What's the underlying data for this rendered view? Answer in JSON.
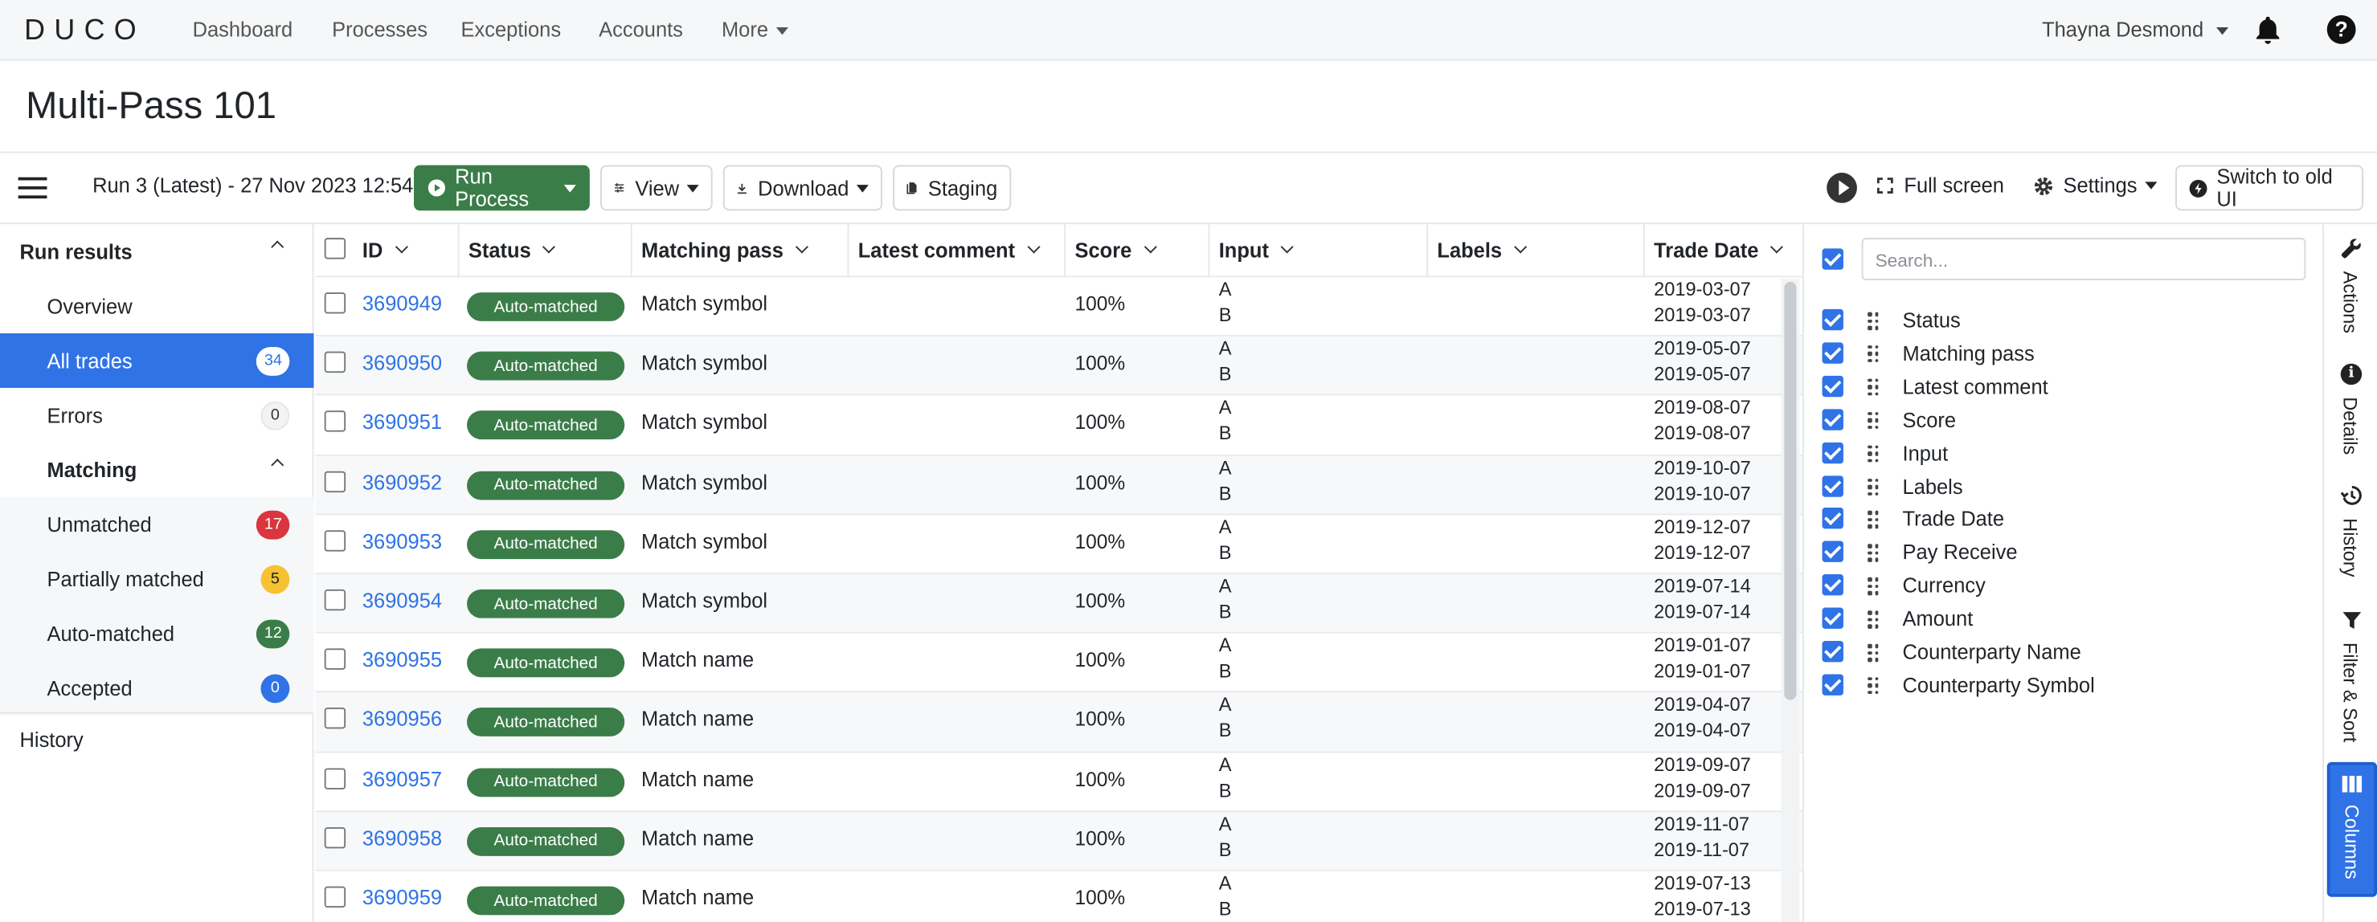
{
  "nav": {
    "logo": "DUCO",
    "links": [
      "Dashboard",
      "Processes",
      "Exceptions",
      "Accounts",
      "More"
    ],
    "user": "Thayna Desmond"
  },
  "page": {
    "title": "Multi-Pass 101"
  },
  "toolbar": {
    "run": "Run 3 (Latest) - 27 Nov 2023 12:54",
    "run_process": "Run Process",
    "view": "View",
    "download": "Download",
    "staging": "Staging",
    "full_screen": "Full screen",
    "settings": "Settings",
    "switch_ui": "Switch to old UI"
  },
  "sidebar": {
    "run_results": "Run results",
    "overview": "Overview",
    "all_trades": "All trades",
    "all_trades_count": "34",
    "errors": "Errors",
    "errors_count": "0",
    "matching": "Matching",
    "unmatched": "Unmatched",
    "unmatched_count": "17",
    "partially": "Partially matched",
    "partially_count": "5",
    "auto": "Auto-matched",
    "auto_count": "12",
    "accepted": "Accepted",
    "accepted_count": "0",
    "history": "History"
  },
  "table": {
    "headers": [
      "ID",
      "Status",
      "Matching pass",
      "Latest comment",
      "Score",
      "Input",
      "Labels",
      "Trade Date"
    ],
    "rows": [
      {
        "id": "3690949",
        "status": "Auto-matched",
        "pass": "Match symbol",
        "score": "100%",
        "in_a": "A",
        "in_b": "B",
        "d1": "2019-03-07",
        "d2": "2019-03-07"
      },
      {
        "id": "3690950",
        "status": "Auto-matched",
        "pass": "Match symbol",
        "score": "100%",
        "in_a": "A",
        "in_b": "B",
        "d1": "2019-05-07",
        "d2": "2019-05-07"
      },
      {
        "id": "3690951",
        "status": "Auto-matched",
        "pass": "Match symbol",
        "score": "100%",
        "in_a": "A",
        "in_b": "B",
        "d1": "2019-08-07",
        "d2": "2019-08-07"
      },
      {
        "id": "3690952",
        "status": "Auto-matched",
        "pass": "Match symbol",
        "score": "100%",
        "in_a": "A",
        "in_b": "B",
        "d1": "2019-10-07",
        "d2": "2019-10-07"
      },
      {
        "id": "3690953",
        "status": "Auto-matched",
        "pass": "Match symbol",
        "score": "100%",
        "in_a": "A",
        "in_b": "B",
        "d1": "2019-12-07",
        "d2": "2019-12-07"
      },
      {
        "id": "3690954",
        "status": "Auto-matched",
        "pass": "Match symbol",
        "score": "100%",
        "in_a": "A",
        "in_b": "B",
        "d1": "2019-07-14",
        "d2": "2019-07-14"
      },
      {
        "id": "3690955",
        "status": "Auto-matched",
        "pass": "Match name",
        "score": "100%",
        "in_a": "A",
        "in_b": "B",
        "d1": "2019-01-07",
        "d2": "2019-01-07"
      },
      {
        "id": "3690956",
        "status": "Auto-matched",
        "pass": "Match name",
        "score": "100%",
        "in_a": "A",
        "in_b": "B",
        "d1": "2019-04-07",
        "d2": "2019-04-07"
      },
      {
        "id": "3690957",
        "status": "Auto-matched",
        "pass": "Match name",
        "score": "100%",
        "in_a": "A",
        "in_b": "B",
        "d1": "2019-09-07",
        "d2": "2019-09-07"
      },
      {
        "id": "3690958",
        "status": "Auto-matched",
        "pass": "Match name",
        "score": "100%",
        "in_a": "A",
        "in_b": "B",
        "d1": "2019-11-07",
        "d2": "2019-11-07"
      },
      {
        "id": "3690959",
        "status": "Auto-matched",
        "pass": "Match name",
        "score": "100%",
        "in_a": "A",
        "in_b": "B",
        "d1": "2019-07-13",
        "d2": "2019-07-13"
      }
    ]
  },
  "columns_panel": {
    "search_placeholder": "Search...",
    "items": [
      "Status",
      "Matching pass",
      "Latest comment",
      "Score",
      "Input",
      "Labels",
      "Trade Date",
      "Pay Receive",
      "Currency",
      "Amount",
      "Counterparty Name",
      "Counterparty Symbol"
    ]
  },
  "rail": {
    "actions": "Actions",
    "details": "Details",
    "history": "History",
    "filter": "Filter & Sort",
    "columns": "Columns"
  },
  "colors": {
    "accent": "#2f73e6",
    "green": "#3b7d49",
    "red": "#d9363e",
    "yellow": "#f5c231",
    "dark_green": "#3b7d49"
  }
}
